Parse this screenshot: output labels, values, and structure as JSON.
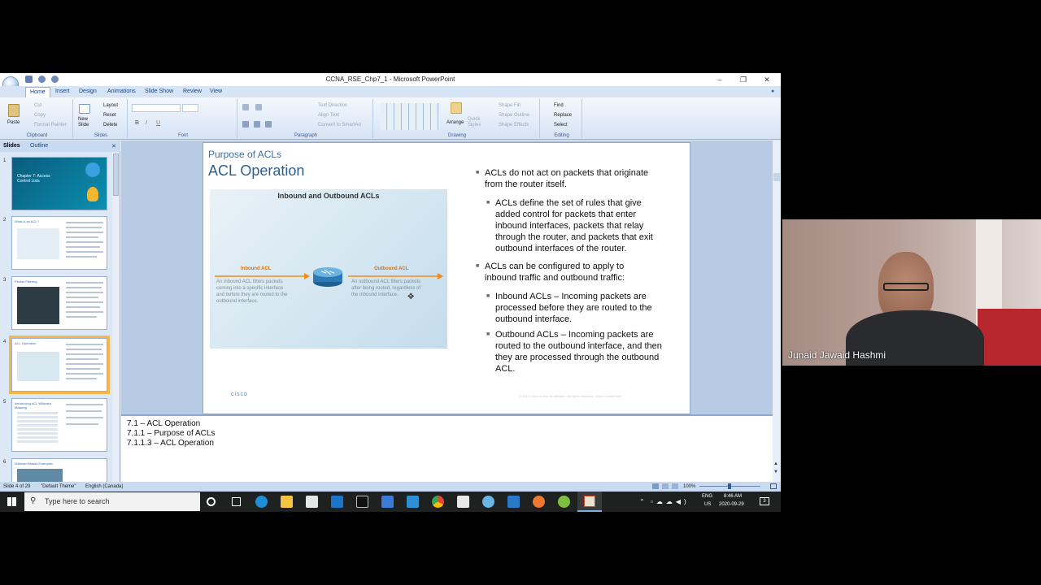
{
  "window": {
    "title": "CCNA_RSE_Chp7_1 - Microsoft PowerPoint",
    "controls": {
      "minimize": "–",
      "maximize": "❐",
      "close": "✕"
    }
  },
  "ribbon_tabs": [
    "Home",
    "Insert",
    "Design",
    "Animations",
    "Slide Show",
    "Review",
    "View"
  ],
  "ribbon": {
    "clipboard": {
      "paste": "Paste",
      "cut": "Cut",
      "copy": "Copy",
      "format_painter": "Format Painter",
      "label": "Clipboard"
    },
    "slides": {
      "new_slide": "New Slide",
      "layout": "Layout",
      "reset": "Reset",
      "delete": "Delete",
      "label": "Slides"
    },
    "font": {
      "label": "Font"
    },
    "paragraph": {
      "text_direction": "Text Direction",
      "align_text": "Align Text",
      "convert_smartart": "Convert to SmartArt",
      "label": "Paragraph"
    },
    "drawing": {
      "arrange": "Arrange",
      "quick_styles": "Quick Styles",
      "shape_fill": "Shape Fill",
      "shape_outline": "Shape Outline",
      "shape_effects": "Shape Effects",
      "label": "Drawing"
    },
    "editing": {
      "find": "Find",
      "replace": "Replace",
      "select": "Select",
      "label": "Editing"
    }
  },
  "panel_tabs": {
    "slides": "Slides",
    "outline": "Outline",
    "close": "✕"
  },
  "thumbnails": [
    {
      "num": "1",
      "title": "Chapter 7: Access Control Lists"
    },
    {
      "num": "2",
      "title": "What is an ACL?"
    },
    {
      "num": "3",
      "title": "Packet Filtering"
    },
    {
      "num": "4",
      "title": "ACL Operation"
    },
    {
      "num": "5",
      "title": "Introducing ACL Wildcard Masking"
    },
    {
      "num": "6",
      "title": "Wildcard Masks Examples"
    }
  ],
  "slide": {
    "subtitle": "Purpose of ACLs",
    "title": "ACL Operation",
    "diagram": {
      "title": "Inbound and Outbound ACLs",
      "inbound_label": "Inbound ACL",
      "inbound_text": [
        "An inbound ACL filters packets",
        "coming into a specific interface",
        "and before they are routed to the",
        "outbound interface."
      ],
      "outbound_label": "Outbound ACL",
      "outbound_text": [
        "An outbound ACL filters packets",
        "after being routed, regardless of",
        "the inbound interface."
      ]
    },
    "bullets": [
      {
        "level": 1,
        "lines": [
          "ACLs do not act on packets that originate",
          "from the router itself."
        ]
      },
      {
        "level": 2,
        "lines": [
          "ACLs define the set of rules that give",
          "added control for packets that enter",
          "inbound interfaces, packets that relay",
          "through the router, and packets that exit",
          "outbound interfaces of the router."
        ]
      },
      {
        "level": 1,
        "lines": [
          "ACLs can be configured to apply to",
          "inbound traffic and outbound traffic:"
        ]
      },
      {
        "level": 2,
        "lines": [
          "Inbound ACLs – Incoming packets are",
          "processed before they are routed to the",
          "outbound interface."
        ]
      },
      {
        "level": 2,
        "lines": [
          "Outbound ACLs – Incoming packets are",
          "routed to the outbound interface, and then",
          "they are processed through the outbound",
          "ACL."
        ]
      }
    ],
    "footer_logo": "cisco",
    "footer_text": "© 2013 Cisco and/or its affiliates. All rights reserved.     Cisco Confidential"
  },
  "notes": [
    "7.1 – ACL Operation",
    "7.1.1 – Purpose of ACLs",
    "7.1.1.3 – ACL Operation"
  ],
  "status": {
    "slide_of": "Slide 4 of 29",
    "theme": "\"Default Theme\"",
    "language": "English (Canada)",
    "zoom": "100%"
  },
  "taskbar": {
    "search_placeholder": "Type here to search",
    "lang1": "ENG",
    "lang2": "US",
    "time": "8:46 AM",
    "date": "2020-09-29",
    "notifications": "3"
  },
  "webcam": {
    "name": "Junaid Jawaid Hashmi"
  }
}
